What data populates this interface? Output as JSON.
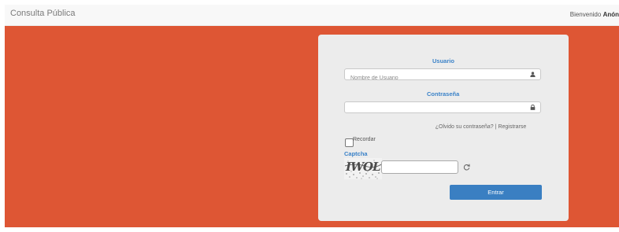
{
  "header": {
    "title": "Consulta Pública",
    "welcome_prefix": "Bienvenido",
    "welcome_user": "Anón"
  },
  "login": {
    "user_label": "Usuario",
    "user_placeholder": "Nombre de Usuario",
    "user_value": "",
    "password_label": "Contraseña",
    "password_value": "",
    "forgot_link": "¿Olvido su contraseña?",
    "separator": "|",
    "register_link": "Registrarse",
    "remember_label": "Recordar",
    "remember_checked": false,
    "captcha_label": "Captcha",
    "captcha_image_text": "IWOL",
    "captcha_value": "",
    "submit_label": "Entrar"
  },
  "icons": {
    "user": "user-icon",
    "lock": "lock-icon",
    "refresh": "refresh-icon"
  },
  "colors": {
    "hero_background": "#de5634",
    "accent": "#3a7fc2",
    "card_background": "#ececec"
  }
}
